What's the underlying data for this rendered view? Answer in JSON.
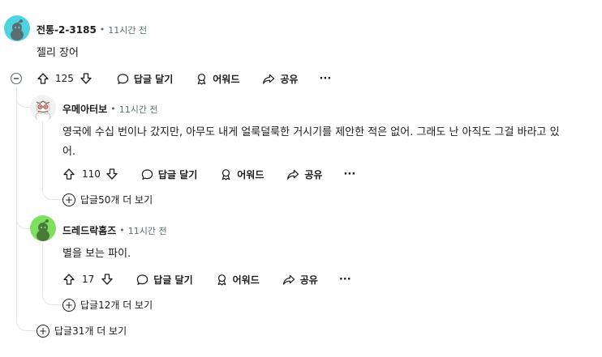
{
  "comments": [
    {
      "author": "전통-2-3185",
      "separator": "•",
      "time": "11시간 전",
      "text": "젤리 장어",
      "score": "125",
      "reply_label": "답글 달기",
      "award_label": "어워드",
      "share_label": "공유",
      "more_label": "···",
      "avatar_color": "#4fd4df"
    },
    {
      "author": "우메아터보",
      "separator": "•",
      "time": "11시간 전",
      "text_line1": "영국에 수십 번이나 갔지만, 아무도 내게 얼룩덜룩한 거시기를 제안한 적은 없어. 그래도 난 아직도 그걸 바라고 있",
      "text_line2": "어.",
      "score": "110",
      "reply_label": "답글 달기",
      "award_label": "어워드",
      "share_label": "공유",
      "more_label": "···",
      "more_replies": "답글50개 더 보기",
      "avatar_color": "#f2f2f2"
    },
    {
      "author": "드레드락홈즈",
      "separator": "•",
      "time": "11시간 전",
      "text": "별을 보는 파이.",
      "score": "17",
      "reply_label": "답글 달기",
      "award_label": "어워드",
      "share_label": "공유",
      "more_label": "···",
      "more_replies": "답글12개 더 보기",
      "avatar_color": "#7fe060"
    }
  ],
  "thread_more_replies": "답글31개 더 보기"
}
